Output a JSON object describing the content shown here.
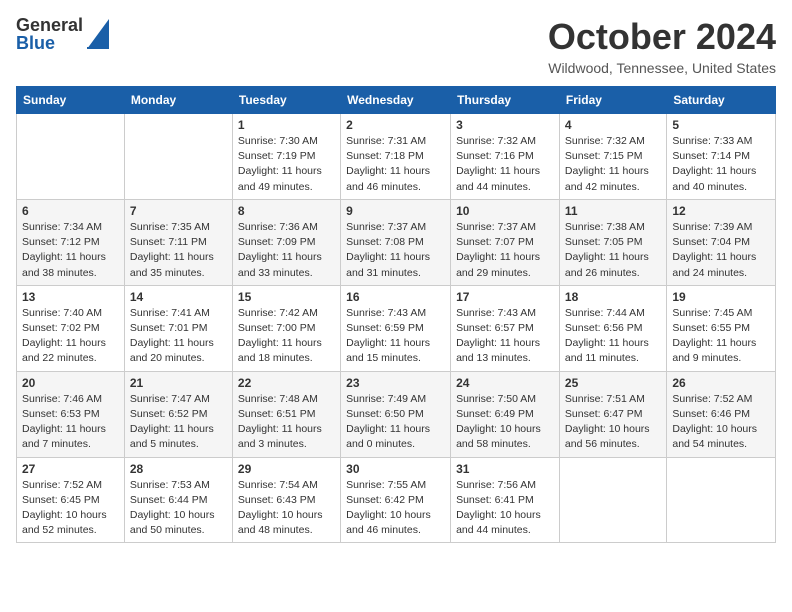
{
  "header": {
    "logo_general": "General",
    "logo_blue": "Blue",
    "month_year": "October 2024",
    "location": "Wildwood, Tennessee, United States"
  },
  "days_of_week": [
    "Sunday",
    "Monday",
    "Tuesday",
    "Wednesday",
    "Thursday",
    "Friday",
    "Saturday"
  ],
  "weeks": [
    [
      {
        "day": "",
        "sunrise": "",
        "sunset": "",
        "daylight": ""
      },
      {
        "day": "",
        "sunrise": "",
        "sunset": "",
        "daylight": ""
      },
      {
        "day": "1",
        "sunrise": "Sunrise: 7:30 AM",
        "sunset": "Sunset: 7:19 PM",
        "daylight": "Daylight: 11 hours and 49 minutes."
      },
      {
        "day": "2",
        "sunrise": "Sunrise: 7:31 AM",
        "sunset": "Sunset: 7:18 PM",
        "daylight": "Daylight: 11 hours and 46 minutes."
      },
      {
        "day": "3",
        "sunrise": "Sunrise: 7:32 AM",
        "sunset": "Sunset: 7:16 PM",
        "daylight": "Daylight: 11 hours and 44 minutes."
      },
      {
        "day": "4",
        "sunrise": "Sunrise: 7:32 AM",
        "sunset": "Sunset: 7:15 PM",
        "daylight": "Daylight: 11 hours and 42 minutes."
      },
      {
        "day": "5",
        "sunrise": "Sunrise: 7:33 AM",
        "sunset": "Sunset: 7:14 PM",
        "daylight": "Daylight: 11 hours and 40 minutes."
      }
    ],
    [
      {
        "day": "6",
        "sunrise": "Sunrise: 7:34 AM",
        "sunset": "Sunset: 7:12 PM",
        "daylight": "Daylight: 11 hours and 38 minutes."
      },
      {
        "day": "7",
        "sunrise": "Sunrise: 7:35 AM",
        "sunset": "Sunset: 7:11 PM",
        "daylight": "Daylight: 11 hours and 35 minutes."
      },
      {
        "day": "8",
        "sunrise": "Sunrise: 7:36 AM",
        "sunset": "Sunset: 7:09 PM",
        "daylight": "Daylight: 11 hours and 33 minutes."
      },
      {
        "day": "9",
        "sunrise": "Sunrise: 7:37 AM",
        "sunset": "Sunset: 7:08 PM",
        "daylight": "Daylight: 11 hours and 31 minutes."
      },
      {
        "day": "10",
        "sunrise": "Sunrise: 7:37 AM",
        "sunset": "Sunset: 7:07 PM",
        "daylight": "Daylight: 11 hours and 29 minutes."
      },
      {
        "day": "11",
        "sunrise": "Sunrise: 7:38 AM",
        "sunset": "Sunset: 7:05 PM",
        "daylight": "Daylight: 11 hours and 26 minutes."
      },
      {
        "day": "12",
        "sunrise": "Sunrise: 7:39 AM",
        "sunset": "Sunset: 7:04 PM",
        "daylight": "Daylight: 11 hours and 24 minutes."
      }
    ],
    [
      {
        "day": "13",
        "sunrise": "Sunrise: 7:40 AM",
        "sunset": "Sunset: 7:02 PM",
        "daylight": "Daylight: 11 hours and 22 minutes."
      },
      {
        "day": "14",
        "sunrise": "Sunrise: 7:41 AM",
        "sunset": "Sunset: 7:01 PM",
        "daylight": "Daylight: 11 hours and 20 minutes."
      },
      {
        "day": "15",
        "sunrise": "Sunrise: 7:42 AM",
        "sunset": "Sunset: 7:00 PM",
        "daylight": "Daylight: 11 hours and 18 minutes."
      },
      {
        "day": "16",
        "sunrise": "Sunrise: 7:43 AM",
        "sunset": "Sunset: 6:59 PM",
        "daylight": "Daylight: 11 hours and 15 minutes."
      },
      {
        "day": "17",
        "sunrise": "Sunrise: 7:43 AM",
        "sunset": "Sunset: 6:57 PM",
        "daylight": "Daylight: 11 hours and 13 minutes."
      },
      {
        "day": "18",
        "sunrise": "Sunrise: 7:44 AM",
        "sunset": "Sunset: 6:56 PM",
        "daylight": "Daylight: 11 hours and 11 minutes."
      },
      {
        "day": "19",
        "sunrise": "Sunrise: 7:45 AM",
        "sunset": "Sunset: 6:55 PM",
        "daylight": "Daylight: 11 hours and 9 minutes."
      }
    ],
    [
      {
        "day": "20",
        "sunrise": "Sunrise: 7:46 AM",
        "sunset": "Sunset: 6:53 PM",
        "daylight": "Daylight: 11 hours and 7 minutes."
      },
      {
        "day": "21",
        "sunrise": "Sunrise: 7:47 AM",
        "sunset": "Sunset: 6:52 PM",
        "daylight": "Daylight: 11 hours and 5 minutes."
      },
      {
        "day": "22",
        "sunrise": "Sunrise: 7:48 AM",
        "sunset": "Sunset: 6:51 PM",
        "daylight": "Daylight: 11 hours and 3 minutes."
      },
      {
        "day": "23",
        "sunrise": "Sunrise: 7:49 AM",
        "sunset": "Sunset: 6:50 PM",
        "daylight": "Daylight: 11 hours and 0 minutes."
      },
      {
        "day": "24",
        "sunrise": "Sunrise: 7:50 AM",
        "sunset": "Sunset: 6:49 PM",
        "daylight": "Daylight: 10 hours and 58 minutes."
      },
      {
        "day": "25",
        "sunrise": "Sunrise: 7:51 AM",
        "sunset": "Sunset: 6:47 PM",
        "daylight": "Daylight: 10 hours and 56 minutes."
      },
      {
        "day": "26",
        "sunrise": "Sunrise: 7:52 AM",
        "sunset": "Sunset: 6:46 PM",
        "daylight": "Daylight: 10 hours and 54 minutes."
      }
    ],
    [
      {
        "day": "27",
        "sunrise": "Sunrise: 7:52 AM",
        "sunset": "Sunset: 6:45 PM",
        "daylight": "Daylight: 10 hours and 52 minutes."
      },
      {
        "day": "28",
        "sunrise": "Sunrise: 7:53 AM",
        "sunset": "Sunset: 6:44 PM",
        "daylight": "Daylight: 10 hours and 50 minutes."
      },
      {
        "day": "29",
        "sunrise": "Sunrise: 7:54 AM",
        "sunset": "Sunset: 6:43 PM",
        "daylight": "Daylight: 10 hours and 48 minutes."
      },
      {
        "day": "30",
        "sunrise": "Sunrise: 7:55 AM",
        "sunset": "Sunset: 6:42 PM",
        "daylight": "Daylight: 10 hours and 46 minutes."
      },
      {
        "day": "31",
        "sunrise": "Sunrise: 7:56 AM",
        "sunset": "Sunset: 6:41 PM",
        "daylight": "Daylight: 10 hours and 44 minutes."
      },
      {
        "day": "",
        "sunrise": "",
        "sunset": "",
        "daylight": ""
      },
      {
        "day": "",
        "sunrise": "",
        "sunset": "",
        "daylight": ""
      }
    ]
  ]
}
